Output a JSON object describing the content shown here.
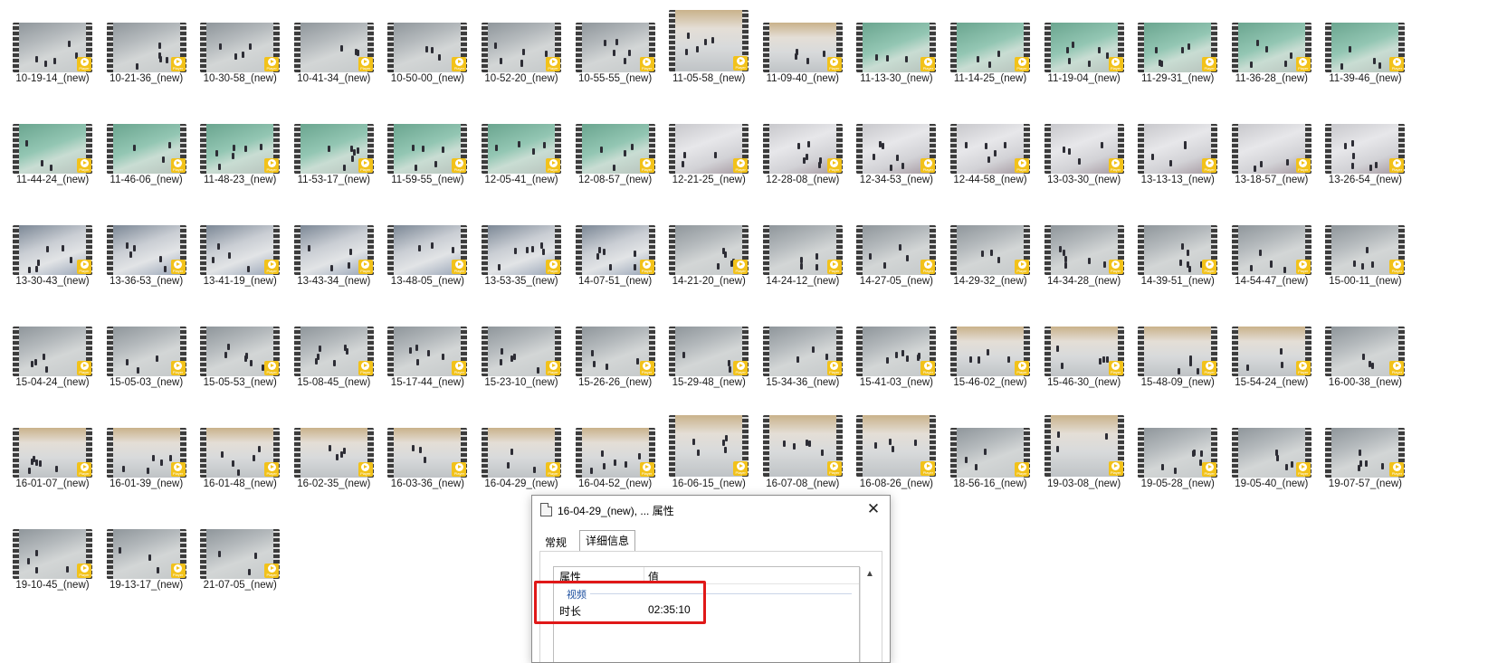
{
  "files": [
    {
      "name": "10-19-14_(new)",
      "scene": "gray"
    },
    {
      "name": "10-21-36_(new)",
      "scene": "gray"
    },
    {
      "name": "10-30-58_(new)",
      "scene": "gray"
    },
    {
      "name": "10-41-34_(new)",
      "scene": "gray"
    },
    {
      "name": "10-50-00_(new)",
      "scene": "gray"
    },
    {
      "name": "10-52-20_(new)",
      "scene": "gray"
    },
    {
      "name": "10-55-55_(new)",
      "scene": "gray"
    },
    {
      "name": "11-05-58_(new)",
      "scene": "hall",
      "tall": true
    },
    {
      "name": "11-09-40_(new)",
      "scene": "hall"
    },
    {
      "name": "11-13-30_(new)",
      "scene": "green"
    },
    {
      "name": "11-14-25_(new)",
      "scene": "green"
    },
    {
      "name": "11-19-04_(new)",
      "scene": "green"
    },
    {
      "name": "11-29-31_(new)",
      "scene": "green"
    },
    {
      "name": "11-36-28_(new)",
      "scene": "green"
    },
    {
      "name": "11-39-46_(new)",
      "scene": "green"
    },
    {
      "name": "11-44-24_(new)",
      "scene": "green"
    },
    {
      "name": "11-46-06_(new)",
      "scene": "green"
    },
    {
      "name": "11-48-23_(new)",
      "scene": "green"
    },
    {
      "name": "11-53-17_(new)",
      "scene": "green"
    },
    {
      "name": "11-59-55_(new)",
      "scene": "green"
    },
    {
      "name": "12-05-41_(new)",
      "scene": "green"
    },
    {
      "name": "12-08-57_(new)",
      "scene": "green"
    },
    {
      "name": "12-21-25_(new)",
      "scene": "white"
    },
    {
      "name": "12-28-08_(new)",
      "scene": "white"
    },
    {
      "name": "12-34-53_(new)",
      "scene": "white"
    },
    {
      "name": "12-44-58_(new)",
      "scene": "white"
    },
    {
      "name": "13-03-30_(new)",
      "scene": "white"
    },
    {
      "name": "13-13-13_(new)",
      "scene": "white"
    },
    {
      "name": "13-18-57_(new)",
      "scene": "white"
    },
    {
      "name": "13-26-54_(new)",
      "scene": "white"
    },
    {
      "name": "13-30-43_(new)",
      "scene": "blue"
    },
    {
      "name": "13-36-53_(new)",
      "scene": "blue"
    },
    {
      "name": "13-41-19_(new)",
      "scene": "blue"
    },
    {
      "name": "13-43-34_(new)",
      "scene": "blue"
    },
    {
      "name": "13-48-05_(new)",
      "scene": "blue"
    },
    {
      "name": "13-53-35_(new)",
      "scene": "blue"
    },
    {
      "name": "14-07-51_(new)",
      "scene": "blue"
    },
    {
      "name": "14-21-20_(new)",
      "scene": "gray"
    },
    {
      "name": "14-24-12_(new)",
      "scene": "gray"
    },
    {
      "name": "14-27-05_(new)",
      "scene": "gray"
    },
    {
      "name": "14-29-32_(new)",
      "scene": "gray"
    },
    {
      "name": "14-34-28_(new)",
      "scene": "gray"
    },
    {
      "name": "14-39-51_(new)",
      "scene": "gray"
    },
    {
      "name": "14-54-47_(new)",
      "scene": "gray"
    },
    {
      "name": "15-00-11_(new)",
      "scene": "gray"
    },
    {
      "name": "15-04-24_(new)",
      "scene": "gray"
    },
    {
      "name": "15-05-03_(new)",
      "scene": "gray"
    },
    {
      "name": "15-05-53_(new)",
      "scene": "gray"
    },
    {
      "name": "15-08-45_(new)",
      "scene": "gray"
    },
    {
      "name": "15-17-44_(new)",
      "scene": "gray"
    },
    {
      "name": "15-23-10_(new)",
      "scene": "gray"
    },
    {
      "name": "15-26-26_(new)",
      "scene": "gray"
    },
    {
      "name": "15-29-48_(new)",
      "scene": "gray"
    },
    {
      "name": "15-34-36_(new)",
      "scene": "gray"
    },
    {
      "name": "15-41-03_(new)",
      "scene": "gray"
    },
    {
      "name": "15-46-02_(new)",
      "scene": "hall"
    },
    {
      "name": "15-46-30_(new)",
      "scene": "hall"
    },
    {
      "name": "15-48-09_(new)",
      "scene": "hall"
    },
    {
      "name": "15-54-24_(new)",
      "scene": "hall"
    },
    {
      "name": "16-00-38_(new)",
      "scene": "gray"
    },
    {
      "name": "16-01-07_(new)",
      "scene": "hall"
    },
    {
      "name": "16-01-39_(new)",
      "scene": "hall"
    },
    {
      "name": "16-01-48_(new)",
      "scene": "hall"
    },
    {
      "name": "16-02-35_(new)",
      "scene": "hall"
    },
    {
      "name": "16-03-36_(new)",
      "scene": "hall"
    },
    {
      "name": "16-04-29_(new)",
      "scene": "hall"
    },
    {
      "name": "16-04-52_(new)",
      "scene": "hall"
    },
    {
      "name": "16-06-15_(new)",
      "scene": "hall",
      "tall": true
    },
    {
      "name": "16-07-08_(new)",
      "scene": "hall",
      "tall": true
    },
    {
      "name": "16-08-26_(new)",
      "scene": "hall",
      "tall": true
    },
    {
      "name": "18-56-16_(new)",
      "scene": "gray"
    },
    {
      "name": "19-03-08_(new)",
      "scene": "hall",
      "tall": true
    },
    {
      "name": "19-05-28_(new)",
      "scene": "gray"
    },
    {
      "name": "19-05-40_(new)",
      "scene": "gray"
    },
    {
      "name": "19-07-57_(new)",
      "scene": "gray"
    },
    {
      "name": "19-10-45_(new)",
      "scene": "gray"
    },
    {
      "name": "19-13-17_(new)",
      "scene": "gray"
    },
    {
      "name": "21-07-05_(new)",
      "scene": "gray"
    }
  ],
  "badge_text": "Player",
  "dialog": {
    "title": "16-04-29_(new), ... 属性",
    "close_glyph": "✕",
    "tabs": [
      "常规",
      "详细信息"
    ],
    "active_tab": "详细信息",
    "column_property": "属性",
    "column_value": "值",
    "group": "视频",
    "row_name": "时长",
    "row_value": "02:35:10",
    "scroll_up_glyph": "▲"
  },
  "colors": {
    "highlight": "#e01818",
    "badge": "#f2c21a"
  }
}
